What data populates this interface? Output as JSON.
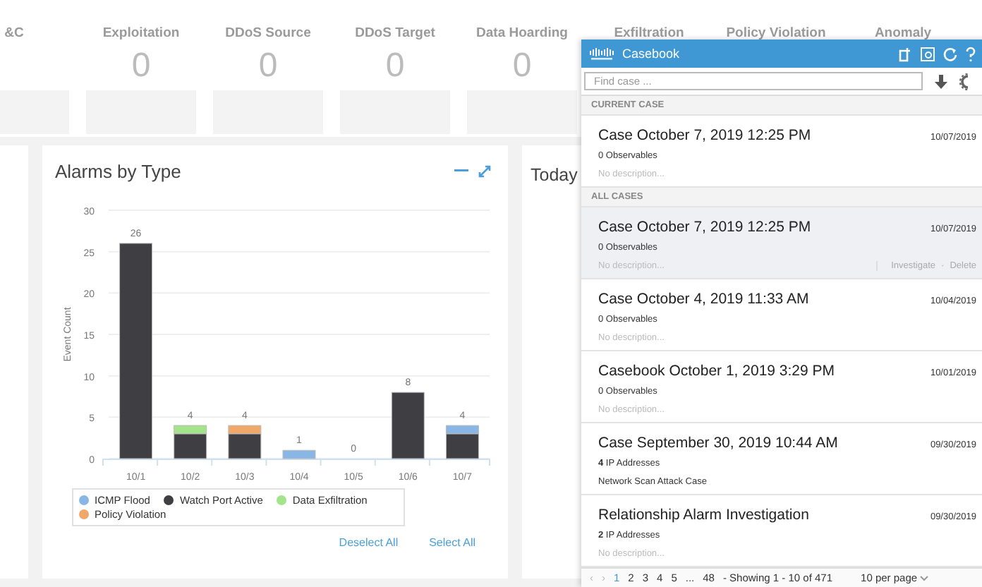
{
  "tiles": [
    {
      "label": "&C"
    },
    {
      "label": "Exploitation",
      "value": "0"
    },
    {
      "label": "DDoS Source",
      "value": "0"
    },
    {
      "label": "DDoS Target",
      "value": "0"
    },
    {
      "label": "Data Hoarding",
      "value": "0"
    },
    {
      "label": "Exfiltration"
    },
    {
      "label": "Policy Violation"
    },
    {
      "label": "Anomaly"
    }
  ],
  "alarms_panel": {
    "title": "Alarms by Type",
    "chart_data": {
      "type": "bar",
      "stacked": true,
      "ylabel": "Event Count",
      "categories": [
        "10/1",
        "10/2",
        "10/3",
        "10/4",
        "10/5",
        "10/6",
        "10/7"
      ],
      "ylim": [
        0,
        30
      ],
      "yticks": [
        0,
        5,
        10,
        15,
        20,
        25,
        30
      ],
      "grid": true,
      "value_labels": [
        [
          null,
          null,
          null,
          "1",
          null,
          null,
          "4"
        ],
        [
          "26",
          "4",
          "4",
          null,
          "0",
          "8",
          null
        ],
        [
          null,
          null,
          null,
          null,
          null,
          null,
          null
        ],
        [
          null,
          null,
          null,
          null,
          null,
          null,
          null
        ]
      ],
      "series": [
        {
          "name": "ICMP Flood",
          "color": "#8ab6e6",
          "values": [
            0,
            0,
            0,
            1,
            0,
            0,
            1
          ]
        },
        {
          "name": "Watch Port Active",
          "color": "#3e3e43",
          "values": [
            26,
            3,
            3,
            0,
            0,
            8,
            3
          ]
        },
        {
          "name": "Data Exfiltration",
          "color": "#a3e38a",
          "values": [
            0,
            1,
            0,
            0,
            0,
            0,
            0
          ]
        },
        {
          "name": "Policy Violation",
          "color": "#f0a76a",
          "values": [
            0,
            0,
            1,
            0,
            0,
            0,
            0
          ]
        }
      ]
    },
    "links": [
      "Deselect All",
      "Select All"
    ]
  },
  "today_panel": {
    "title": "Today"
  },
  "casebook": {
    "title": "Casebook",
    "search": {
      "placeholder": "Find case ..."
    },
    "sections": [
      {
        "heading": "CURRENT CASE",
        "cases": [
          {
            "title": "Case October 7, 2019 12:25 PM",
            "date": "10/07/2019",
            "count": "0 Observables",
            "description": "No description...",
            "description_placeholder": true,
            "selected": false
          }
        ]
      },
      {
        "heading": "ALL CASES",
        "cases": [
          {
            "title": "Case October 7, 2019 12:25 PM",
            "date": "10/07/2019",
            "count": "0 Observables",
            "description": "No description...",
            "description_placeholder": true,
            "selected": true,
            "actions": [
              "Investigate",
              "Delete"
            ]
          },
          {
            "title": "Case October 4, 2019 11:33 AM",
            "date": "10/04/2019",
            "count": "0 Observables",
            "description": "No description...",
            "description_placeholder": true,
            "selected": false
          },
          {
            "title": "Casebook October 1, 2019 3:29 PM",
            "date": "10/01/2019",
            "count": "0 Observables",
            "description": "No description...",
            "description_placeholder": true,
            "selected": false
          },
          {
            "title": "Case September 30, 2019 10:44 AM",
            "date": "09/30/2019",
            "count": "**4** IP Addresses",
            "description": "Network Scan Attack Case",
            "description_placeholder": false,
            "selected": false
          },
          {
            "title": "Relationship Alarm Investigation",
            "date": "09/30/2019",
            "count": "**2** IP Addresses",
            "description": "No description...",
            "description_placeholder": true,
            "selected": false
          }
        ]
      }
    ],
    "action_separator": "·",
    "pagination": {
      "prev": "‹",
      "next": "›",
      "pages": [
        {
          "label": "1",
          "selected": true
        },
        {
          "label": "2",
          "selected": false
        },
        {
          "label": "3",
          "selected": false
        },
        {
          "label": "4",
          "selected": false
        },
        {
          "label": "5",
          "selected": false
        }
      ],
      "ellipsis": "...",
      "last_page": "48",
      "showing": "- Showing 1 - 10 of 471",
      "per_page": "10 per page"
    }
  }
}
